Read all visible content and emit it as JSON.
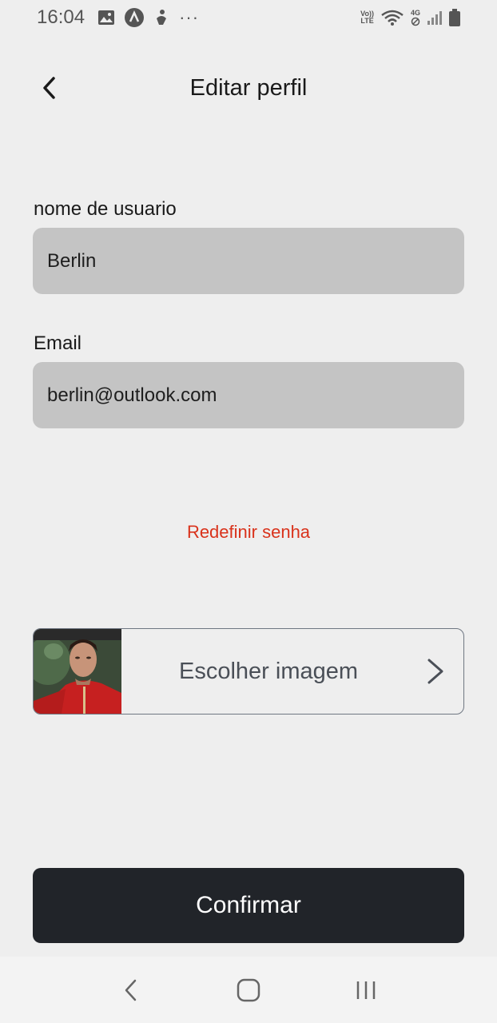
{
  "status_bar": {
    "time": "16:04",
    "icons": [
      "gallery-icon",
      "app-a-icon",
      "accessibility-icon",
      "more-icon"
    ],
    "network_text_top": "Vo))",
    "network_text_bottom": "LTE",
    "mobile_text": "4G",
    "overflow": "···"
  },
  "header": {
    "title": "Editar perfil"
  },
  "form": {
    "username_label": "nome de usuario",
    "username_value": "Berlin",
    "email_label": "Email",
    "email_value": "berlin@outlook.com"
  },
  "reset_password_label": "Redefinir senha",
  "image_chooser": {
    "label": "Escolher imagem"
  },
  "confirm_label": "Confirmar",
  "colors": {
    "background": "#eeeeee",
    "input_bg": "#c4c4c4",
    "link": "#d9321b",
    "button_bg": "#212429"
  }
}
